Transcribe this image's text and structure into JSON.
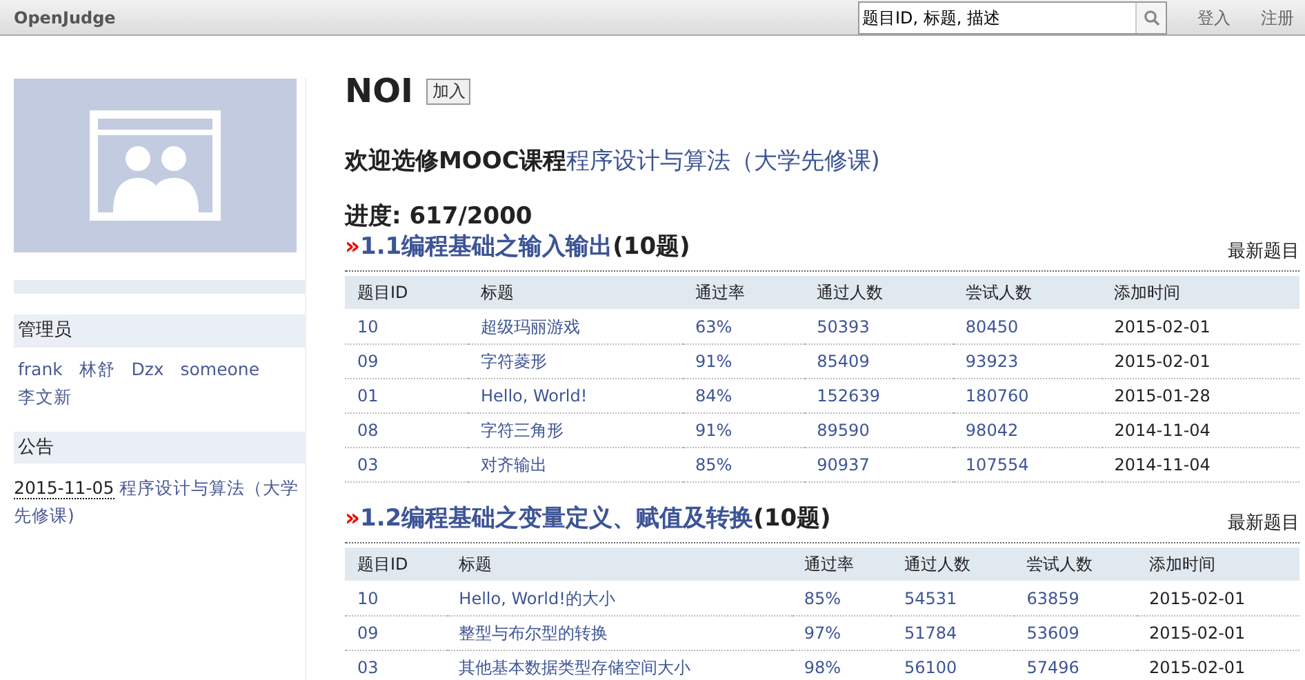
{
  "navbar": {
    "brand": "OpenJudge",
    "search": {
      "value": "题目ID, 标题, 描述"
    },
    "links": [
      "登入",
      "注册"
    ]
  },
  "sidebar": {
    "admins": {
      "title": "管理员",
      "names": [
        "frank",
        "林舒",
        "Dzx",
        "someone",
        "李文新"
      ]
    },
    "notices": {
      "title": "公告",
      "items": [
        {
          "date": "2015-11-05",
          "text": "程序设计与算法（大学先修课)"
        }
      ]
    }
  },
  "group": {
    "name": "NOI",
    "join": "加入"
  },
  "welcome": {
    "text": "欢迎选修MOOC课程",
    "link": "程序设计与算法（大学先修课)"
  },
  "progress": "进度: 617/2000",
  "sections": [
    {
      "mark": "»",
      "title": "1.1编程基础之输入输出",
      "count": "(10题)",
      "latest": "最新题目",
      "columns": [
        "题目ID",
        "标题",
        "通过率",
        "通过人数",
        "尝试人数",
        "添加时间"
      ],
      "rows": [
        [
          "10",
          "超级玛丽游戏",
          "63%",
          "50393",
          "80450",
          "2015-02-01"
        ],
        [
          "09",
          "字符菱形",
          "91%",
          "85409",
          "93923",
          "2015-02-01"
        ],
        [
          "01",
          "Hello, World!",
          "84%",
          "152639",
          "180760",
          "2015-01-28"
        ],
        [
          "08",
          "字符三角形",
          "91%",
          "89590",
          "98042",
          "2014-11-04"
        ],
        [
          "03",
          "对齐输出",
          "85%",
          "90937",
          "107554",
          "2014-11-04"
        ]
      ]
    },
    {
      "mark": "»",
      "title": "1.2编程基础之变量定义、赋值及转换",
      "count": "(10题)",
      "latest": "最新题目",
      "columns": [
        "题目ID",
        "标题",
        "通过率",
        "通过人数",
        "尝试人数",
        "添加时间"
      ],
      "rows": [
        [
          "10",
          "Hello, World!的大小",
          "85%",
          "54531",
          "63859",
          "2015-02-01"
        ],
        [
          "09",
          "整型与布尔型的转换",
          "97%",
          "51784",
          "53609",
          "2015-02-01"
        ],
        [
          "03",
          "其他基本数据类型存储空间大小",
          "98%",
          "56100",
          "57496",
          "2015-02-01"
        ]
      ]
    }
  ]
}
